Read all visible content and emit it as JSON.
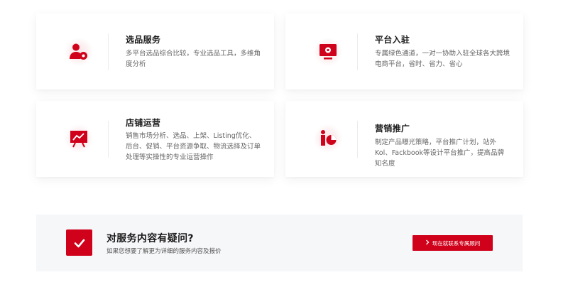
{
  "services": [
    {
      "id": "selection",
      "title": "选品服务",
      "desc": "多平台选品综合比较，专业选品工具，多维角度分析",
      "icon": "user-gear-icon"
    },
    {
      "id": "platform",
      "title": "平台入驻",
      "desc": "专属绿色通道，一对一协助入驻全球各大跨境电商平台，省时、省力、省心",
      "icon": "monitor-gear-icon"
    },
    {
      "id": "store-ops",
      "title": "店铺运营",
      "desc": "销售市场分析、选品、上架、Listing优化、后台、促销、平台资源争取、物流选择及订单处理等实操性的专业运营操作",
      "icon": "presentation-chart-icon"
    },
    {
      "id": "marketing",
      "title": "营销推广",
      "desc": "制定产品曝光策略，平台推广计划，站外Kol、Fackbook等设计平台推广，提高品牌知名度",
      "icon": "presenter-pie-chart-icon"
    }
  ],
  "cta": {
    "title": "对服务内容有疑问?",
    "subtitle": "如果您想要了解更为详细的服务内容及报价",
    "button_label": "现在就联系专属顾问",
    "icon": "checkmark-icon"
  },
  "colors": {
    "accent": "#d0021b",
    "band_bg": "#f6f7f9",
    "title_text": "#1a1a1a",
    "desc_text": "#666666"
  }
}
